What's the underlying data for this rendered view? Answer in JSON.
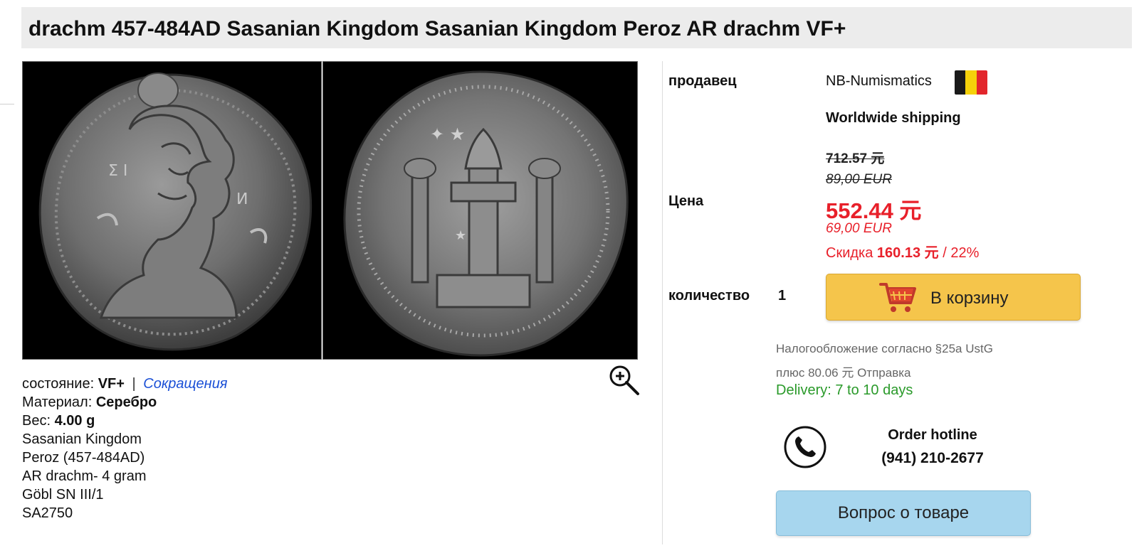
{
  "product": {
    "title": "drachm 457-484AD Sasanian Kingdom Sasanian Kingdom Peroz AR drachm VF+",
    "images": [
      {
        "side": "obverse",
        "icon": "coin-obverse-image"
      },
      {
        "side": "reverse",
        "icon": "coin-reverse-image"
      }
    ],
    "zoom_icon": "magnifier-plus-icon"
  },
  "details": {
    "condition_label": "состояние:",
    "condition_value": "VF+",
    "separator": "|",
    "abbreviations_link": "Сокращения",
    "material_label": "Материал:",
    "material_value": "Серебро",
    "weight_label": "Вес:",
    "weight_value": "4.00 g",
    "lines": [
      "Sasanian Kingdom",
      "Peroz (457-484AD)",
      "AR drachm- 4 gram",
      "Göbl SN III/1",
      "SA2750"
    ]
  },
  "seller": {
    "label": "продавец",
    "name": "NB-Numismatics",
    "flag_icon": "belgium-flag-icon",
    "flag_colors": [
      "#1a1a1a",
      "#f5d10a",
      "#e2262c"
    ],
    "shipping": "Worldwide shipping"
  },
  "price": {
    "label": "Цена",
    "old_cny": "712.57 元",
    "old_eur": "89,00 EUR",
    "current_cny": "552.44 元",
    "current_eur": "69,00 EUR",
    "discount_label": "Скидка",
    "discount_amount": "160.13 元",
    "discount_percent": "/ 22%"
  },
  "quantity": {
    "label": "количество",
    "value": "1"
  },
  "cart_button": {
    "label": "В корзину",
    "icon": "shopping-cart-icon",
    "color": "#f5c54b"
  },
  "tax": {
    "note": "Налогообложение согласно §25a UstG",
    "shipping_cost": "плюс 80.06 元 Отправка",
    "delivery": "Delivery: 7 to 10 days"
  },
  "hotline": {
    "icon": "phone-icon",
    "label": "Order hotline",
    "number": "(941) 210-2677"
  },
  "question_button": {
    "label": "Вопрос о товаре",
    "color": "#a7d6ee"
  },
  "colors": {
    "price_red": "#e8202a",
    "delivery_green": "#2a9a2a",
    "link_blue": "#1a4fd6"
  }
}
